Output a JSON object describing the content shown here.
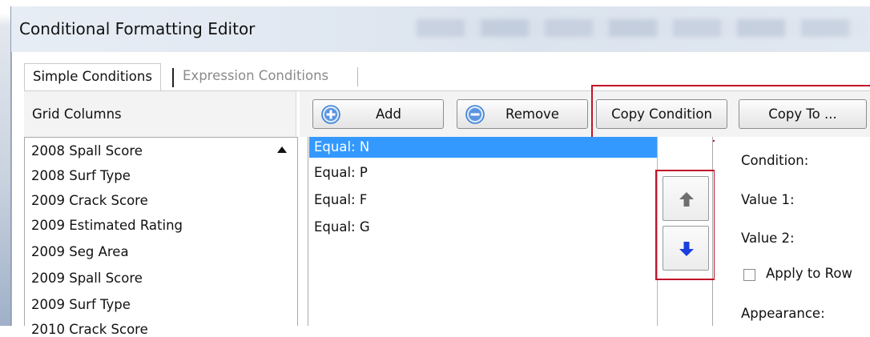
{
  "window": {
    "title": "Conditional Formatting Editor"
  },
  "tabs": [
    {
      "label": "Simple Conditions",
      "active": true
    },
    {
      "label": "Expression Conditions",
      "active": false
    }
  ],
  "grid_columns": {
    "header": "Grid Columns",
    "items": [
      "2008 Spall Score",
      "2008 Surf Type",
      "2009 Crack Score",
      "2009 Estimated Rating",
      "2009 Seg Area",
      "2009 Spall Score",
      "2009 Surf Type",
      "2010 Crack Score"
    ]
  },
  "toolbar": {
    "add_label": "Add",
    "remove_label": "Remove",
    "copy_condition_label": "Copy Condition",
    "copy_to_label": "Copy To ..."
  },
  "conditions": {
    "items": [
      "Equal: N",
      "Equal: P",
      "Equal: F",
      "Equal: G"
    ],
    "selected_index": 0
  },
  "details": {
    "condition_label": "Condition:",
    "value1_label": "Value 1:",
    "value2_label": "Value 2:",
    "apply_to_row_label": "Apply to Row",
    "apply_to_row_checked": false,
    "appearance_label": "Appearance:"
  },
  "colors": {
    "selection": "#3399ff",
    "highlight_box": "#c0142a",
    "add_icon": "#3b7fd6",
    "down_arrow": "#1a3fe0",
    "up_arrow": "#6e6e6e"
  }
}
